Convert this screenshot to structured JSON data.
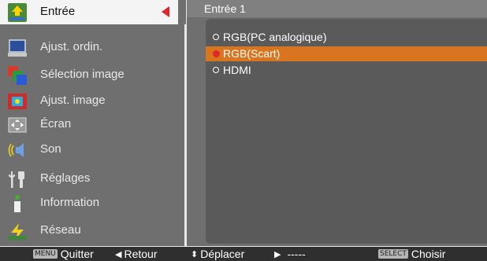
{
  "menu": {
    "items": [
      {
        "label": "Entrée",
        "icon": "input-icon",
        "active": true
      },
      {
        "label": "Ajust. ordin.",
        "icon": "computer-icon"
      },
      {
        "label": "Sélection image",
        "icon": "image-select-icon"
      },
      {
        "label": "Ajust. image",
        "icon": "image-adjust-icon"
      },
      {
        "label": "Écran",
        "icon": "screen-icon"
      },
      {
        "label": "Son",
        "icon": "sound-icon"
      },
      {
        "label": "Réglages",
        "icon": "settings-icon"
      },
      {
        "label": "Information",
        "icon": "info-icon"
      },
      {
        "label": "Réseau",
        "icon": "network-icon"
      }
    ]
  },
  "panel": {
    "title": "Entrée 1",
    "options": [
      {
        "label": "RGB(PC analogique)",
        "selected": false
      },
      {
        "label": "RGB(Scart)",
        "selected": true
      },
      {
        "label": "HDMI",
        "selected": false
      }
    ]
  },
  "footer": {
    "quit_key": "MENU",
    "quit": "Quitter",
    "back": "Retour",
    "move": "Déplacer",
    "next": "-----",
    "select_key": "SELECT",
    "choose": "Choisir"
  },
  "colors": {
    "accent": "#d9751f",
    "marker": "#e0262a",
    "menu_bg": "#6f6f6f",
    "list_bg": "#5a5a5a",
    "footer_bg": "#2f2f2f"
  }
}
